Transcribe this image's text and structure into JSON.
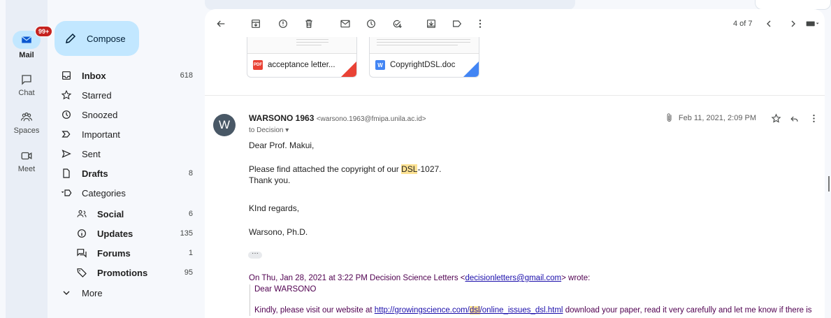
{
  "rail": {
    "mail": {
      "label": "Mail",
      "badge": "99+"
    },
    "chat": {
      "label": "Chat"
    },
    "spaces": {
      "label": "Spaces"
    },
    "meet": {
      "label": "Meet"
    }
  },
  "compose_label": "Compose",
  "nav": [
    {
      "label": "Inbox",
      "count": "618",
      "icon": "inbox-icon",
      "bold": true
    },
    {
      "label": "Starred",
      "count": "",
      "icon": "star-icon",
      "bold": false
    },
    {
      "label": "Snoozed",
      "count": "",
      "icon": "clock-icon",
      "bold": false
    },
    {
      "label": "Important",
      "count": "",
      "icon": "important-icon",
      "bold": false
    },
    {
      "label": "Sent",
      "count": "",
      "icon": "send-icon",
      "bold": false
    },
    {
      "label": "Drafts",
      "count": "8",
      "icon": "draft-icon",
      "bold": true
    },
    {
      "label": "Categories",
      "count": "",
      "icon": "label-icon",
      "bold": false
    },
    {
      "label": "Social",
      "count": "6",
      "icon": "people-icon",
      "bold": true
    },
    {
      "label": "Updates",
      "count": "135",
      "icon": "info-icon",
      "bold": true
    },
    {
      "label": "Forums",
      "count": "1",
      "icon": "forum-icon",
      "bold": true
    },
    {
      "label": "Promotions",
      "count": "95",
      "icon": "tag-icon",
      "bold": true
    },
    {
      "label": "More",
      "count": "",
      "icon": "chevron-down-icon",
      "bold": false
    }
  ],
  "toolbar": {
    "pager": "4 of 7"
  },
  "attachments": [
    {
      "name": "acceptance letter...",
      "type": "PDF",
      "color": "#e94235"
    },
    {
      "name": "CopyrightDSL.doc",
      "type": "W",
      "color": "#4285f4"
    }
  ],
  "message": {
    "avatar": "W",
    "sender_name": "WARSONO 1963",
    "sender_email": "<warsono.1963@fmipa.unila.ac.id>",
    "to": "to Decision",
    "date": "Feb 11, 2021, 2:09 PM",
    "greeting": "Dear Prof. Makui,",
    "line1_pre": "Please find attached the copyright of our ",
    "line1_hl": "DSL",
    "line1_post": "-1027.",
    "line2": "Thank you.",
    "closing": "KInd regards,",
    "signature": "Warsono, Ph.D.",
    "quote_head_pre": "On Thu, Jan 28, 2021 at 3:22 PM Decision Science Letters <",
    "quote_head_link": "decisionletters@gmail.com",
    "quote_head_post": "> wrote:",
    "quote_greeting": "Dear WARSONO",
    "quote_line_pre": "Kindly, please visit our website at ",
    "quote_link_a": "http://growingscience.com/",
    "quote_link_hl": "dsl",
    "quote_link_b": "/online_issues_dsl.html",
    "quote_line_post": " download your paper, read it very carefully and let me know if there is"
  }
}
